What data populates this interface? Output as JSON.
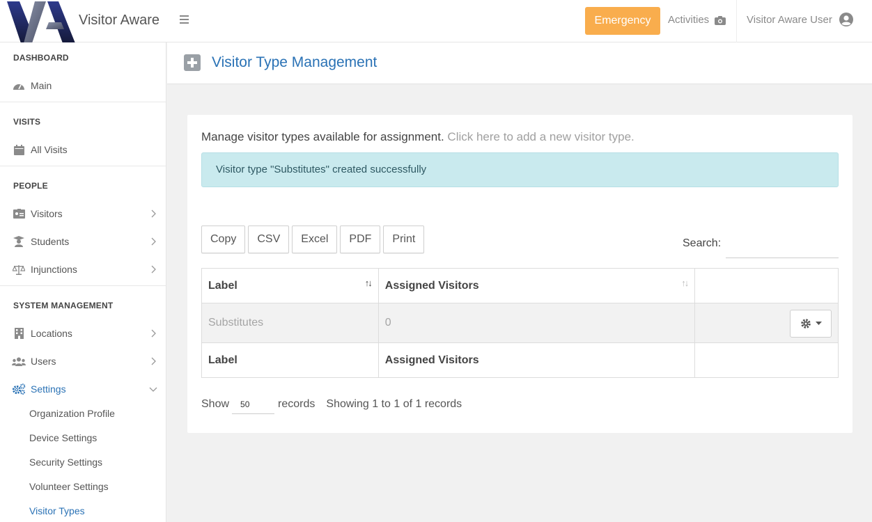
{
  "app": {
    "brand": "Visitor Aware",
    "colors": {
      "accent": "#2a72b5",
      "emergency": "#f9ad4d",
      "alert_bg": "#c9eaee"
    }
  },
  "header": {
    "emergency_label": "Emergency",
    "activities_label": "Activities",
    "user_name": "Visitor Aware User"
  },
  "sidebar": {
    "sections": {
      "dashboard": "DASHBOARD",
      "visits": "VISITS",
      "people": "PEOPLE",
      "system": "SYSTEM MANAGEMENT"
    },
    "items": {
      "main": "Main",
      "all_visits": "All Visits",
      "visitors": "Visitors",
      "students": "Students",
      "injunctions": "Injunctions",
      "locations": "Locations",
      "users": "Users",
      "settings": "Settings"
    },
    "settings_sub": {
      "org_profile": "Organization Profile",
      "device_settings": "Device Settings",
      "security_settings": "Security Settings",
      "volunteer_settings": "Volunteer Settings",
      "visitor_types": "Visitor Types"
    }
  },
  "page": {
    "title": "Visitor Type Management",
    "intro": "Manage visitor types available for assignment.",
    "add_link": "Click here to add a new visitor type.",
    "alert": "Visitor type \"Substitutes\" created successfully",
    "buttons": {
      "copy": "Copy",
      "csv": "CSV",
      "excel": "Excel",
      "pdf": "PDF",
      "print": "Print"
    },
    "search_label": "Search:",
    "table": {
      "col_label": "Label",
      "col_assigned": "Assigned Visitors",
      "rows": [
        {
          "label": "Substitutes",
          "assigned": "0"
        }
      ]
    },
    "footer": {
      "show": "Show",
      "length_value": "50",
      "records": "records",
      "info": "Showing 1 to 1 of 1 records"
    }
  }
}
